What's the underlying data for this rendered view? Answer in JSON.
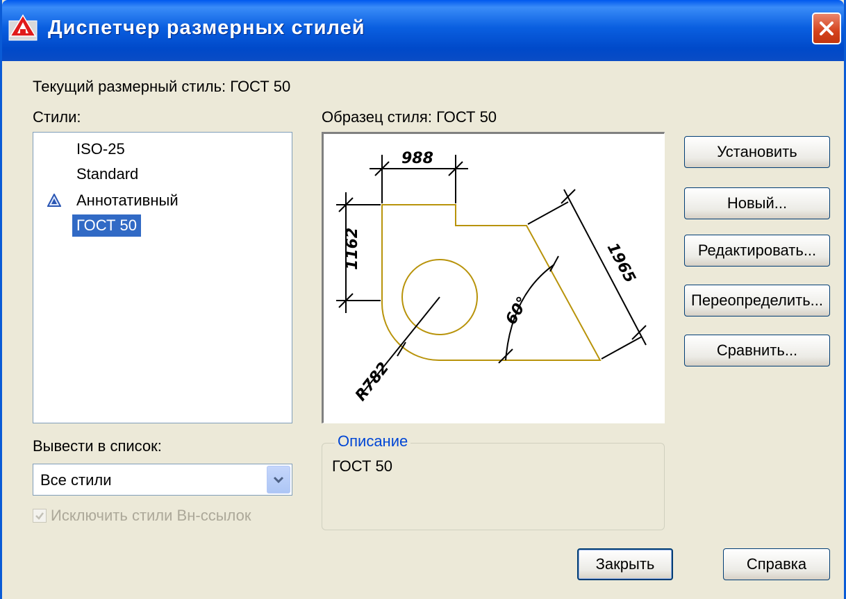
{
  "window": {
    "title": "Диспетчер размерных стилей"
  },
  "current_style": {
    "label": "Текущий размерный стиль: ГОСТ 50"
  },
  "styles": {
    "label": "Стили:",
    "items": [
      {
        "label": "ISO-25",
        "annotative": false,
        "selected": false
      },
      {
        "label": "Standard",
        "annotative": false,
        "selected": false
      },
      {
        "label": "Аннотативный",
        "annotative": true,
        "selected": false
      },
      {
        "label": "ГОСТ 50",
        "annotative": false,
        "selected": true
      }
    ]
  },
  "preview": {
    "label": "Образец стиля: ГОСТ 50",
    "dims": {
      "top": "988",
      "left": "1162",
      "slant": "1965",
      "angle": "60°",
      "radius": "R782"
    }
  },
  "buttons": {
    "set": "Установить",
    "new": "Новый...",
    "modify": "Редактировать...",
    "override": "Переопределить...",
    "compare": "Сравнить...",
    "close": "Закрыть",
    "help": "Справка"
  },
  "list_filter": {
    "label": "Вывести в список:",
    "value": "Все стили"
  },
  "exclude_xref": {
    "label": "Исключить стили Вн-ссылок",
    "checked": true,
    "enabled": false
  },
  "description": {
    "legend": "Описание",
    "text": "ГОСТ 50"
  },
  "colors": {
    "titlebar": "#0a5fe0",
    "dialog": "#ece9d8",
    "selection": "#316ac5",
    "geometry": "#b8930a",
    "group_legend": "#0046d5"
  }
}
